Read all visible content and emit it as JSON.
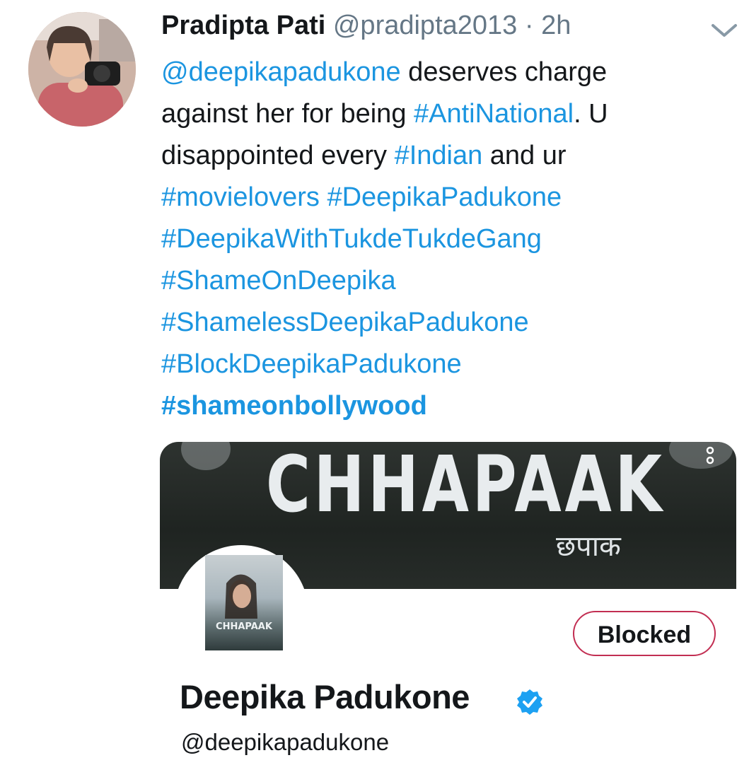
{
  "tweet": {
    "author_name": "Pradipta Pati",
    "author_handle": "@pradipta2013",
    "separator": "·",
    "time": "2h",
    "lines": [
      [
        {
          "t": "@deepikapadukone",
          "k": "link"
        },
        {
          "t": " deserves charge",
          "k": "text"
        }
      ],
      [
        {
          "t": "against her for being ",
          "k": "text"
        },
        {
          "t": "#AntiNational",
          "k": "link"
        },
        {
          "t": ". U",
          "k": "text"
        }
      ],
      [
        {
          "t": "disappointed every ",
          "k": "text"
        },
        {
          "t": "#Indian",
          "k": "link"
        },
        {
          "t": " and ur",
          "k": "text"
        }
      ],
      [
        {
          "t": "#movielovers",
          "k": "link"
        },
        {
          "t": " ",
          "k": "text"
        },
        {
          "t": "#DeepikaPadukone",
          "k": "link"
        }
      ],
      [
        {
          "t": "#DeepikaWithTukdeTukdeGang",
          "k": "link"
        }
      ],
      [
        {
          "t": "#ShameOnDeepika",
          "k": "link"
        }
      ],
      [
        {
          "t": "#ShamelessDeepikaPadukone",
          "k": "link"
        }
      ],
      [
        {
          "t": "#BlockDeepikaPadukone",
          "k": "link"
        }
      ],
      [
        {
          "t": "#shameonbollywood",
          "k": "linkb"
        }
      ]
    ]
  },
  "card": {
    "banner_title": "CHHAPAAK",
    "banner_subtitle": "छपाक",
    "profile_name": "Deepika Padukone",
    "profile_handle": "@deepikapadukone",
    "blocked_label": "Blocked",
    "poster_title": "CHHAPAAK"
  },
  "icons": {
    "menu": "chevron-down-icon",
    "verified": "verified-badge-icon",
    "back": "back-arrow-icon",
    "more": "more-vertical-icon"
  },
  "colors": {
    "link": "#1b95e0",
    "blocked_border": "#c22e52",
    "muted": "#657786"
  }
}
